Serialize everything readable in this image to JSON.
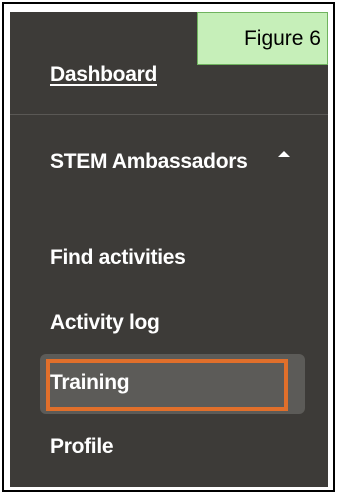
{
  "figure_label": "Figure 6",
  "nav": {
    "dashboard": "Dashboard",
    "section": {
      "title": "STEM Ambassadors",
      "expanded": true,
      "items": [
        {
          "label": "Find activities",
          "active": false
        },
        {
          "label": "Activity log",
          "active": false
        },
        {
          "label": "Training",
          "active": true
        },
        {
          "label": "Profile",
          "active": false
        }
      ]
    }
  },
  "colors": {
    "sidebar_bg": "#3d3b38",
    "active_bg": "#5c5b58",
    "highlight": "#e06f2b",
    "label_bg": "#c6efb9"
  }
}
